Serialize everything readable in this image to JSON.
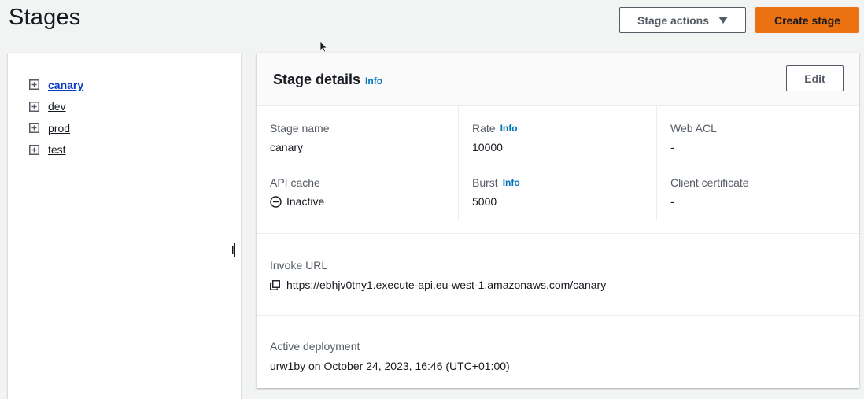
{
  "page": {
    "title": "Stages",
    "stage_actions_label": "Stage actions",
    "create_stage_label": "Create stage"
  },
  "tree": {
    "items": [
      {
        "label": "canary",
        "active": true
      },
      {
        "label": "dev",
        "active": false
      },
      {
        "label": "prod",
        "active": false
      },
      {
        "label": "test",
        "active": false
      }
    ]
  },
  "details": {
    "title": "Stage details",
    "info_label": "Info",
    "edit_label": "Edit",
    "stage_name_label": "Stage name",
    "stage_name_value": "canary",
    "rate_label": "Rate",
    "rate_value": "10000",
    "web_acl_label": "Web ACL",
    "web_acl_value": "-",
    "api_cache_label": "API cache",
    "api_cache_value": "Inactive",
    "burst_label": "Burst",
    "burst_value": "5000",
    "client_cert_label": "Client certificate",
    "client_cert_value": "-",
    "invoke_url_label": "Invoke URL",
    "invoke_url_value": "https://ebhjv0tny1.execute-api.eu-west-1.amazonaws.com/canary",
    "active_deployment_label": "Active deployment",
    "active_deployment_value": "urw1by on October 24, 2023, 16:46 (UTC+01:00)"
  },
  "colors": {
    "accent": "#ec7211",
    "link": "#0073bb",
    "active_link": "#0b3bc6"
  },
  "icons": {
    "stage_actions": "caret-down-icon",
    "tree_expand": "plus-square-icon",
    "api_cache_status": "minus-circle-icon",
    "invoke_url": "copy-icon",
    "cursor": "mouse-pointer-icon",
    "resize": "resize-handle-icon"
  }
}
